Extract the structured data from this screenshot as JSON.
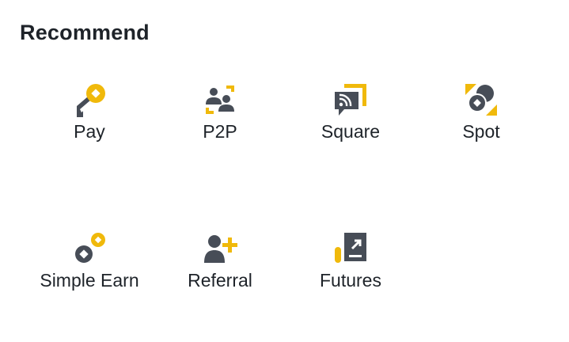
{
  "section": {
    "title": "Recommend"
  },
  "colors": {
    "accent": "#F0B90B",
    "icon_dark": "#474D57",
    "text": "#1E2329"
  },
  "items": [
    {
      "label": "Pay",
      "icon": "pay-icon"
    },
    {
      "label": "P2P",
      "icon": "p2p-icon"
    },
    {
      "label": "Square",
      "icon": "square-icon"
    },
    {
      "label": "Spot",
      "icon": "spot-icon"
    },
    {
      "label": "Simple Earn",
      "icon": "simple-earn-icon"
    },
    {
      "label": "Referral",
      "icon": "referral-icon"
    },
    {
      "label": "Futures",
      "icon": "futures-icon"
    }
  ]
}
